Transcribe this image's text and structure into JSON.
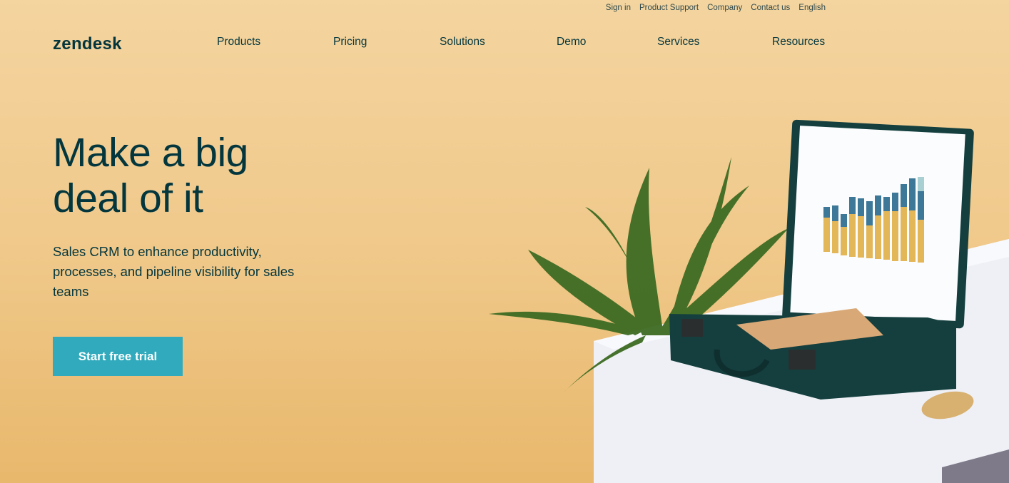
{
  "utility_nav": [
    "Sign in",
    "Product Support",
    "Company",
    "Contact us",
    "English"
  ],
  "logo": "zendesk",
  "nav": [
    "Products",
    "Pricing",
    "Solutions",
    "Demo",
    "Services",
    "Resources"
  ],
  "hero": {
    "headline_line1": "Make a big",
    "headline_line2": "deal of it",
    "subtitle": "Sales CRM to enhance productivity, processes, and pipeline visibility for sales teams",
    "cta": "Start free trial"
  },
  "colors": {
    "brand_dark": "#03363d",
    "cta": "#30aabc",
    "background": "#f0c98b"
  }
}
